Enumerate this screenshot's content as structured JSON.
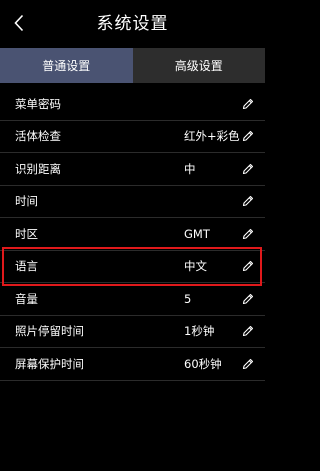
{
  "header": {
    "title": "系统设置",
    "back_icon": "chevron-left-icon"
  },
  "tabs": [
    {
      "label": "普通设置",
      "active": true
    },
    {
      "label": "高级设置",
      "active": false
    }
  ],
  "settings": [
    {
      "label": "菜单密码",
      "value": ""
    },
    {
      "label": "活体检查",
      "value": "红外+彩色"
    },
    {
      "label": "识别距离",
      "value": "中"
    },
    {
      "label": "时间",
      "value": ""
    },
    {
      "label": "时区",
      "value": "GMT"
    },
    {
      "label": "语言",
      "value": "中文"
    },
    {
      "label": "音量",
      "value": "5"
    },
    {
      "label": "照片停留时间",
      "value": "1秒钟"
    },
    {
      "label": "屏幕保护时间",
      "value": "60秒钟"
    }
  ],
  "selected_setting": "语言",
  "edit_icon": "pencil-icon",
  "colors": {
    "background": "#000000",
    "tab_active": "#4a5372",
    "tab_inactive": "#2d2d2d",
    "highlight": "#e0191b",
    "text": "#ffffff"
  }
}
